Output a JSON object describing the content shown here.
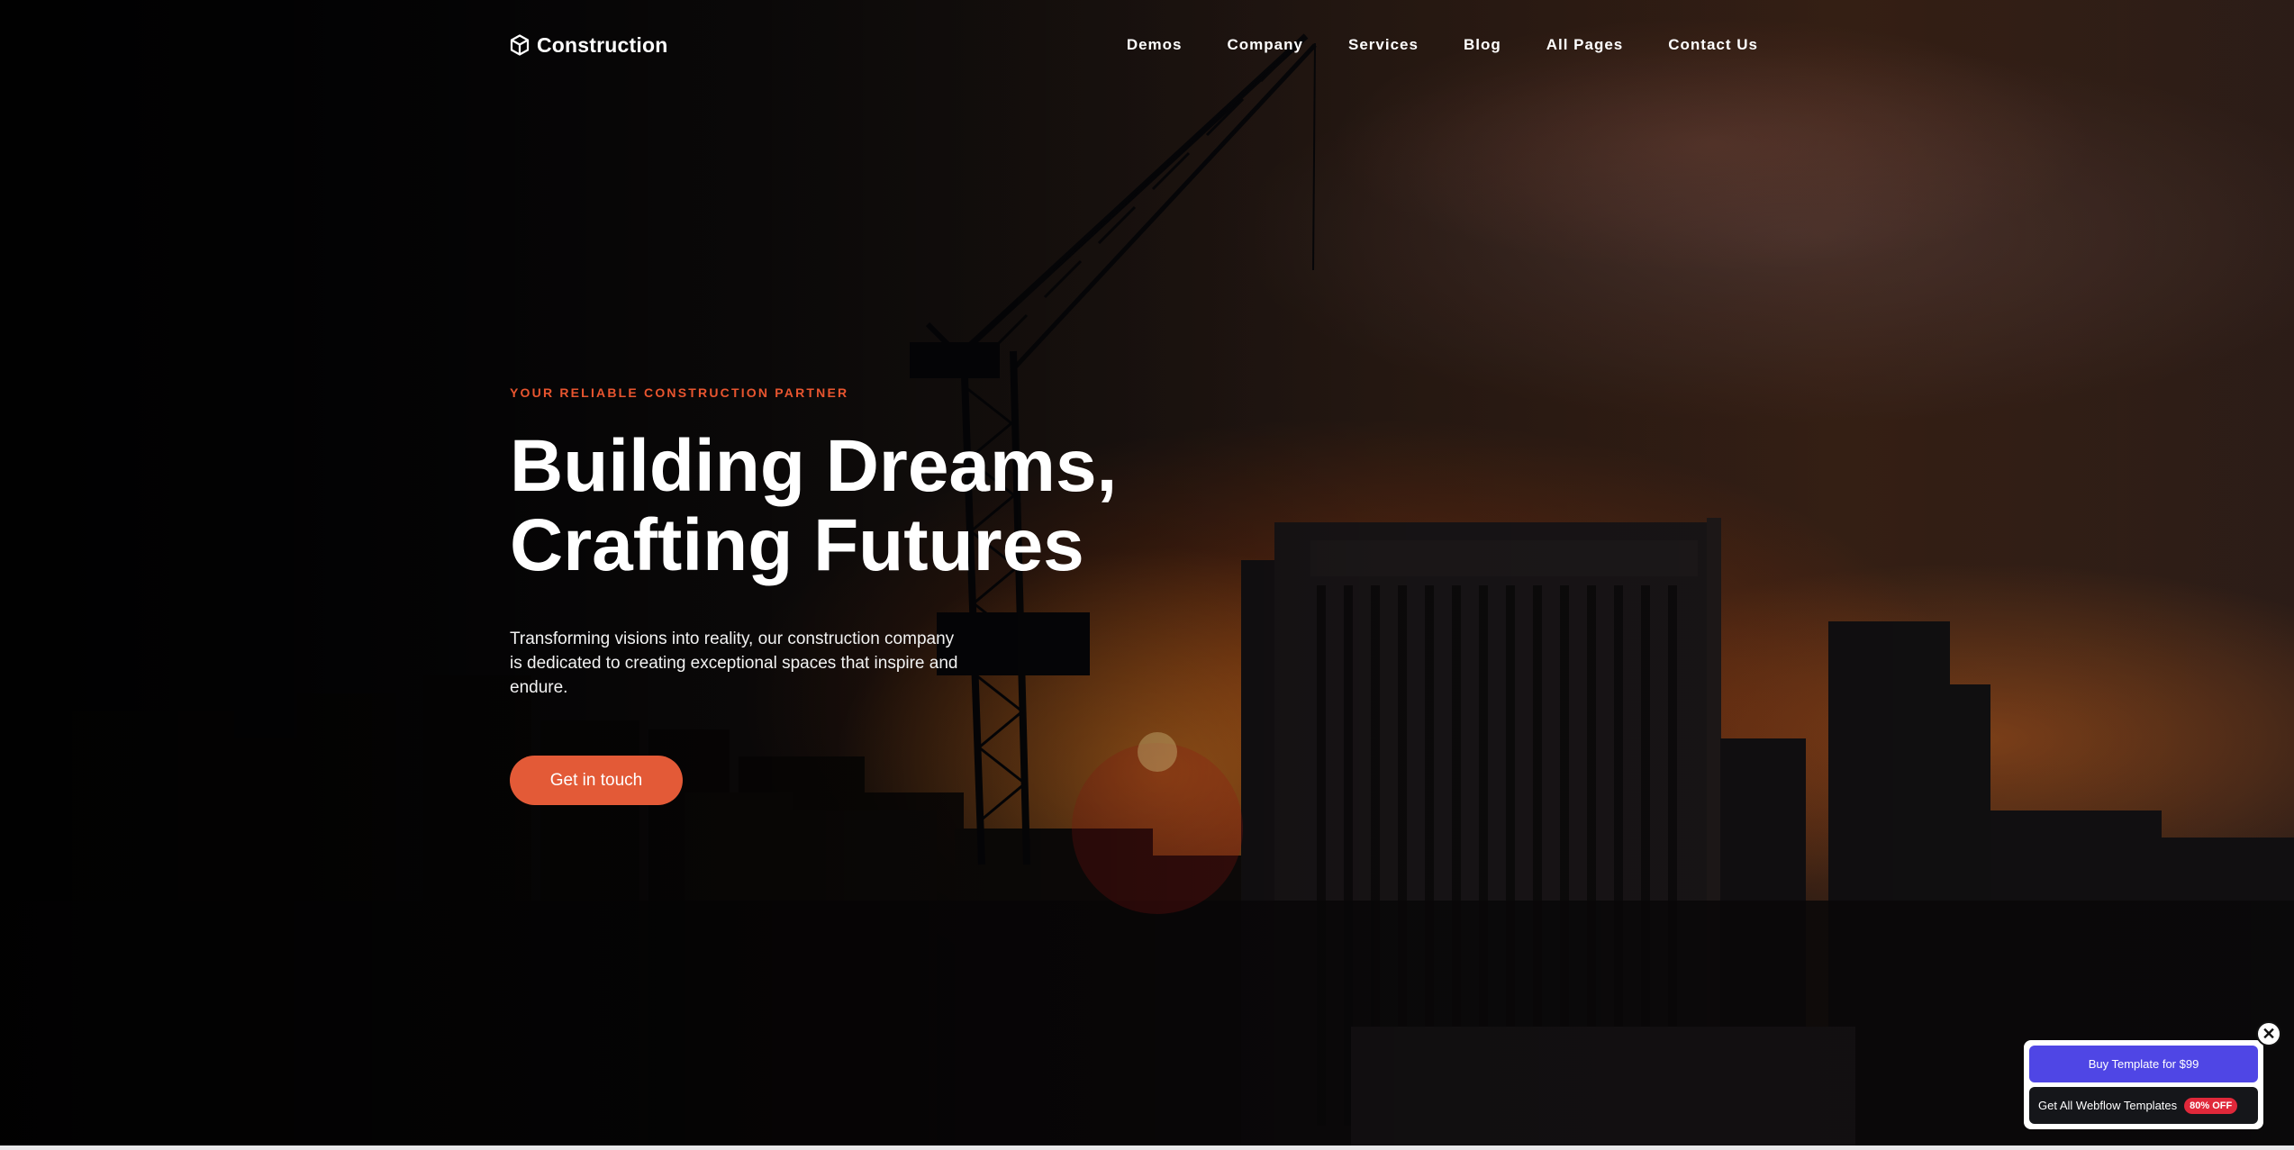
{
  "brand": {
    "name": "Construction",
    "icon": "cube-icon"
  },
  "nav": {
    "items": [
      {
        "label": "Demos"
      },
      {
        "label": "Company"
      },
      {
        "label": "Services"
      },
      {
        "label": "Blog"
      },
      {
        "label": "All Pages"
      },
      {
        "label": "Contact Us"
      }
    ]
  },
  "hero": {
    "eyebrow": "YOUR RELIABLE CONSTRUCTION PARTNER",
    "headline_line1": "Building Dreams,",
    "headline_line2": "Crafting Futures",
    "description": "Transforming visions into reality, our construction company is dedicated to creating exceptional spaces that inspire and endure.",
    "cta_label": "Get in touch"
  },
  "promo": {
    "close_icon": "close-icon",
    "buy_label": "Buy Template for $99",
    "all_label": "Get All Webflow Templates",
    "badge": "80% OFF"
  },
  "colors": {
    "accent": "#e35a37",
    "eyebrow": "#e8552f",
    "promo_primary": "#4f46e5",
    "promo_badge": "#e0283a"
  }
}
